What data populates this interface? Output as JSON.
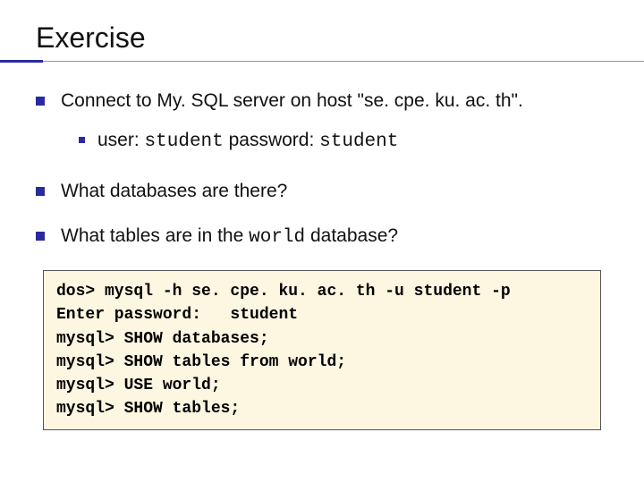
{
  "title": "Exercise",
  "bullets": {
    "b1_pre": "Connect to My. SQL server on host \"",
    "b1_host": "se. cpe. ku. ac. th",
    "b1_post": "\".",
    "sub_user_label": "user: ",
    "sub_user_val": "student",
    "sub_pass_label": "  password: ",
    "sub_pass_val": "student",
    "b2": "What databases are there?",
    "b3_pre": "What tables are in the ",
    "b3_mono": "world",
    "b3_post": " database?"
  },
  "code": "dos> mysql -h se. cpe. ku. ac. th -u student -p\nEnter password:   student\nmysql> SHOW databases;\nmysql> SHOW tables from world;\nmysql> USE world;\nmysql> SHOW tables;"
}
